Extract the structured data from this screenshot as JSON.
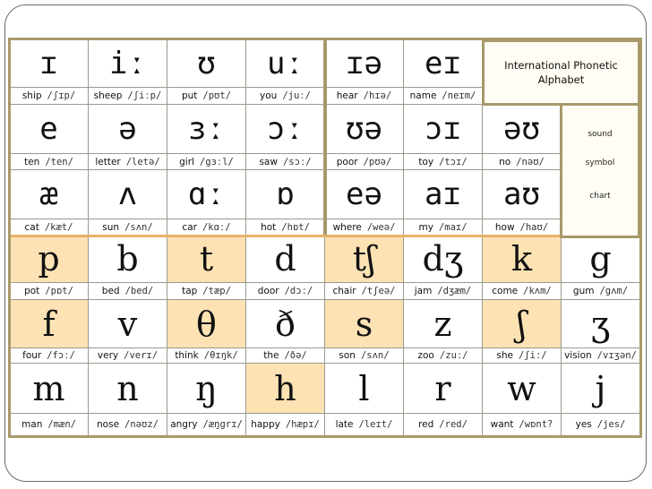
{
  "title": {
    "line1": "International Phonetic",
    "line2": "Alphabet"
  },
  "side_labels": [
    "sound",
    "symbol",
    "chart"
  ],
  "colors": {
    "highlight": "#fde2b3",
    "frame": "#a8996a",
    "consonant_border": "#e8b26a"
  },
  "vowels": [
    [
      {
        "symbol": "ɪ",
        "word": "ship",
        "ipa": "/ʃɪp/"
      },
      {
        "symbol": "iː",
        "word": "sheep",
        "ipa": "/ʃiːp/"
      },
      {
        "symbol": "ʊ",
        "word": "put",
        "ipa": "/pʊt/"
      },
      {
        "symbol": "uː",
        "word": "you",
        "ipa": "/juː/"
      },
      {
        "symbol": "ɪə",
        "word": "hear",
        "ipa": "/hɪə/"
      },
      {
        "symbol": "eɪ",
        "word": "name",
        "ipa": "/neɪm/"
      }
    ],
    [
      {
        "symbol": "e",
        "word": "ten",
        "ipa": "/ten/"
      },
      {
        "symbol": "ə",
        "word": "letter",
        "ipa": "/letə/"
      },
      {
        "symbol": "ɜː",
        "word": "girl",
        "ipa": "/gɜːl/"
      },
      {
        "symbol": "ɔː",
        "word": "saw",
        "ipa": "/sɔː/"
      },
      {
        "symbol": "ʊə",
        "word": "poor",
        "ipa": "/pʊə/"
      },
      {
        "symbol": "ɔɪ",
        "word": "toy",
        "ipa": "/tɔɪ/"
      },
      {
        "symbol": "əʊ",
        "word": "no",
        "ipa": "/nəʊ/"
      }
    ],
    [
      {
        "symbol": "æ",
        "word": "cat",
        "ipa": "/kæt/"
      },
      {
        "symbol": "ʌ",
        "word": "sun",
        "ipa": "/sʌn/"
      },
      {
        "symbol": "ɑː",
        "word": "car",
        "ipa": "/kɑː/"
      },
      {
        "symbol": "ɒ",
        "word": "hot",
        "ipa": "/hɒt/"
      },
      {
        "symbol": "eə",
        "word": "where",
        "ipa": "/weə/"
      },
      {
        "symbol": "aɪ",
        "word": "my",
        "ipa": "/maɪ/"
      },
      {
        "symbol": "aʊ",
        "word": "how",
        "ipa": "/haʊ/"
      }
    ]
  ],
  "consonants": [
    [
      {
        "symbol": "p",
        "word": "pot",
        "ipa": "/pɒt/",
        "highlight": true
      },
      {
        "symbol": "b",
        "word": "bed",
        "ipa": "/bed/",
        "highlight": false
      },
      {
        "symbol": "t",
        "word": "tap",
        "ipa": "/tæp/",
        "highlight": true
      },
      {
        "symbol": "d",
        "word": "door",
        "ipa": "/dɔː/",
        "highlight": false
      },
      {
        "symbol": "tʃ",
        "word": "chair",
        "ipa": "/tʃeə/",
        "highlight": true
      },
      {
        "symbol": "dʒ",
        "word": "jam",
        "ipa": "/dʒæm/",
        "highlight": false
      },
      {
        "symbol": "k",
        "word": "come",
        "ipa": "/kʌm/",
        "highlight": true
      },
      {
        "symbol": "g",
        "word": "gum",
        "ipa": "/gʌm/",
        "highlight": false
      }
    ],
    [
      {
        "symbol": "f",
        "word": "four",
        "ipa": "/fɔː/",
        "highlight": true
      },
      {
        "symbol": "v",
        "word": "very",
        "ipa": "/verɪ/",
        "highlight": false
      },
      {
        "symbol": "θ",
        "word": "think",
        "ipa": "/θɪŋk/",
        "highlight": true
      },
      {
        "symbol": "ð",
        "word": "the",
        "ipa": "/ðə/",
        "highlight": false
      },
      {
        "symbol": "s",
        "word": "son",
        "ipa": "/sʌn/",
        "highlight": true
      },
      {
        "symbol": "z",
        "word": "zoo",
        "ipa": "/zuː/",
        "highlight": false
      },
      {
        "symbol": "ʃ",
        "word": "she",
        "ipa": "/ʃiː/",
        "highlight": true
      },
      {
        "symbol": "ʒ",
        "word": "vision",
        "ipa": "/vɪʒən/",
        "highlight": false
      }
    ],
    [
      {
        "symbol": "m",
        "word": "man",
        "ipa": "/mæn/",
        "highlight": false
      },
      {
        "symbol": "n",
        "word": "nose",
        "ipa": "/nəʊz/",
        "highlight": false
      },
      {
        "symbol": "ŋ",
        "word": "angry",
        "ipa": "/æŋgrɪ/",
        "highlight": false
      },
      {
        "symbol": "h",
        "word": "happy",
        "ipa": "/hæpɪ/",
        "highlight": true
      },
      {
        "symbol": "l",
        "word": "late",
        "ipa": "/leɪt/",
        "highlight": false
      },
      {
        "symbol": "r",
        "word": "red",
        "ipa": "/red/",
        "highlight": false
      },
      {
        "symbol": "w",
        "word": "want",
        "ipa": "/wɒnt?",
        "highlight": false
      },
      {
        "symbol": "j",
        "word": "yes",
        "ipa": "/jes/",
        "highlight": false
      }
    ]
  ]
}
